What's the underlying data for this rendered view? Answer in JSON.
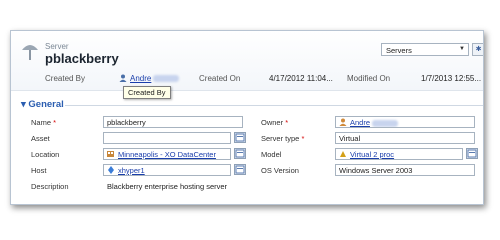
{
  "header": {
    "entity_type": "Server",
    "record_title": "pblackberry",
    "form_selector": "Servers"
  },
  "meta": {
    "created_by_label": "Created By",
    "created_by_value": "Andre",
    "created_on_label": "Created On",
    "created_on_value": "4/17/2012 11:04...",
    "modified_on_label": "Modified On",
    "modified_on_value": "1/7/2013 12:55..."
  },
  "tooltip": "Created By",
  "section": {
    "title": "General"
  },
  "fields": {
    "name": {
      "label": "Name",
      "value": "pblackberry"
    },
    "asset": {
      "label": "Asset",
      "value": ""
    },
    "location": {
      "label": "Location",
      "value": "Minneapolis - XO DataCenter"
    },
    "host": {
      "label": "Host",
      "value": "xhyper1"
    },
    "description": {
      "label": "Description",
      "value": "Blackberry enterprise hosting server"
    },
    "owner": {
      "label": "Owner",
      "value": "Andre"
    },
    "server_type": {
      "label": "Server type",
      "value": "Virtual"
    },
    "model": {
      "label": "Model",
      "value": "Virtual 2 proc"
    },
    "os_version": {
      "label": "OS Version",
      "value": "Windows Server 2003"
    }
  },
  "icons": [
    "server-entity-icon",
    "user-icon",
    "lookup-icon",
    "location-icon",
    "host-icon",
    "model-icon",
    "dropdown-arrow-icon",
    "settings-icon"
  ]
}
